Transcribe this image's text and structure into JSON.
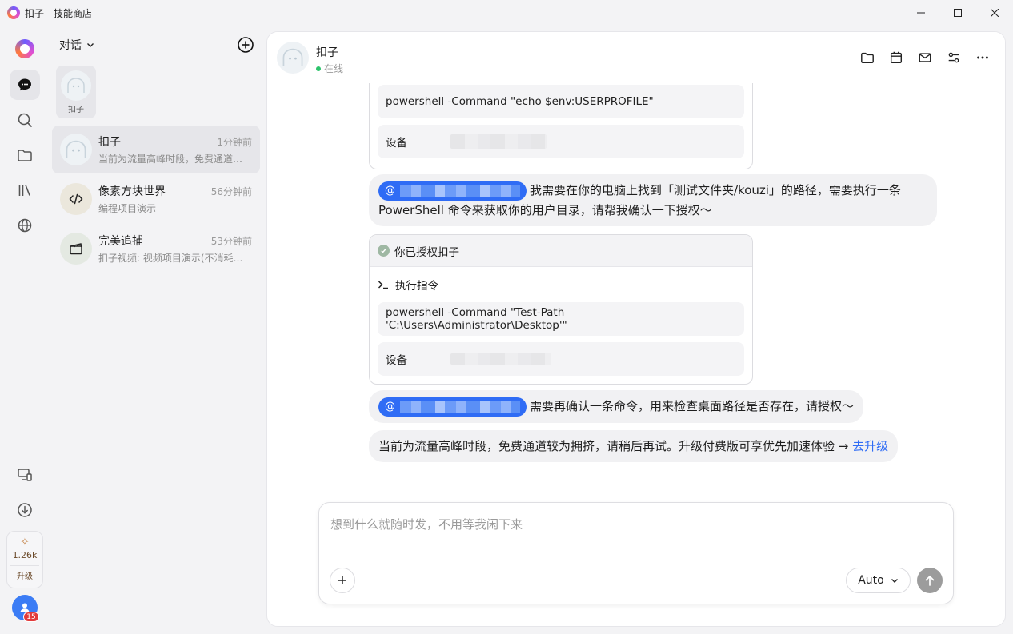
{
  "window": {
    "title": "扣子 - 技能商店"
  },
  "conversations": {
    "header": "对话",
    "pinned_label": "扣子",
    "items": [
      {
        "name": "扣子",
        "time": "1分钟前",
        "preview": "当前为流量高峰时段，免费通道较为拥挤，请稍后再试。"
      },
      {
        "name": "像素方块世界",
        "time": "56分钟前",
        "preview": "编程项目演示"
      },
      {
        "name": "完美追捕",
        "time": "53分钟前",
        "preview": "扣子视频: 视频项目演示(不消耗积分)"
      }
    ]
  },
  "rail": {
    "credits": "1.26k",
    "upgrade": "升级",
    "badge": "15"
  },
  "chat": {
    "name": "扣子",
    "status": "在线",
    "card1": {
      "command": "powershell -Command \"echo $env:USERPROFILE\"",
      "device_label": "设备"
    },
    "msg1": "我需要在你的电脑上找到「测试文件夹/kouzi」的路径，需要执行一条 PowerShell 命令来获取你的用户目录，请帮我确认一下授权～",
    "card2": {
      "authorized": "你已授权扣子",
      "exec_label": "执行指令",
      "command": "powershell -Command \"Test-Path 'C:\\Users\\Administrator\\Desktop'\"",
      "device_label": "设备"
    },
    "msg2": "需要再确认一条命令，用来检查桌面路径是否存在，请授权～",
    "msg3": "当前为流量高峰时段，免费通道较为拥挤，请稍后再试。升级付费版可享优先加速体验 →",
    "msg3_link": "去升级"
  },
  "composer": {
    "placeholder": "想到什么就随时发，不用等我闲下来",
    "mode": "Auto"
  }
}
